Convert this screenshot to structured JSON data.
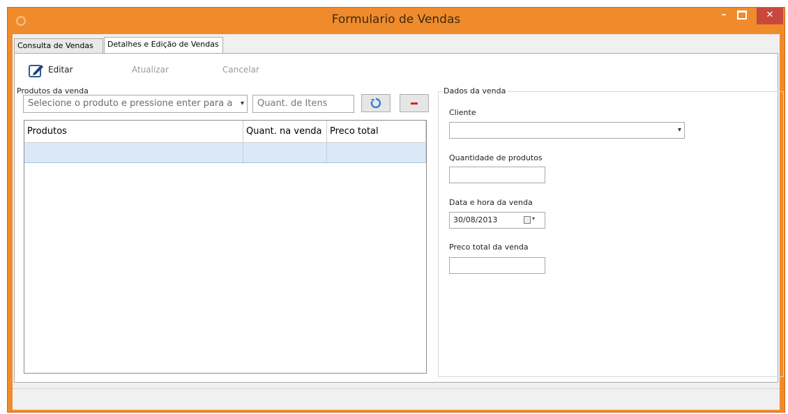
{
  "window": {
    "title": "Formulario de Vendas",
    "minimize_icon": "minimize-icon",
    "maximize_icon": "maximize-icon",
    "close_icon": "close-icon",
    "minimize_glyph": "–",
    "close_glyph": "✕"
  },
  "tabs": [
    {
      "label": "Consulta de Vendas",
      "selected": false
    },
    {
      "label": "Detalhes e Edição de Vendas",
      "selected": true
    }
  ],
  "toolbar": {
    "edit_label": "Editar",
    "update_label": "Atualizar",
    "cancel_label": "Cancelar"
  },
  "products_section": {
    "label": "Produtos da venda",
    "product_combo_text": "Selecione o produto e pressione enter para ac",
    "quantity_placeholder": "Quant. de Itens",
    "refresh_icon": "refresh-icon",
    "remove_icon": "minus-icon",
    "grid": {
      "columns": [
        "Produtos",
        "Quant. na venda",
        "Preco total"
      ],
      "rows": [
        [
          "",
          "",
          ""
        ]
      ]
    }
  },
  "sale_data": {
    "label": "Dados da venda",
    "client_label": "Cliente",
    "client_value": "",
    "quantity_label": "Quantidade de produtos",
    "quantity_value": "",
    "datetime_label": "Data e hora da venda",
    "datetime_value": "30/08/2013",
    "calendar_icon": "calendar-icon",
    "total_label": "Preco total da venda",
    "total_value": ""
  },
  "colors": {
    "titlebar": "#f08b2b",
    "close_button": "#c9483c",
    "selected_row": "#dbe9f7",
    "remove_button_red": "#e0202a",
    "refresh_blue": "#2f7fd8"
  }
}
